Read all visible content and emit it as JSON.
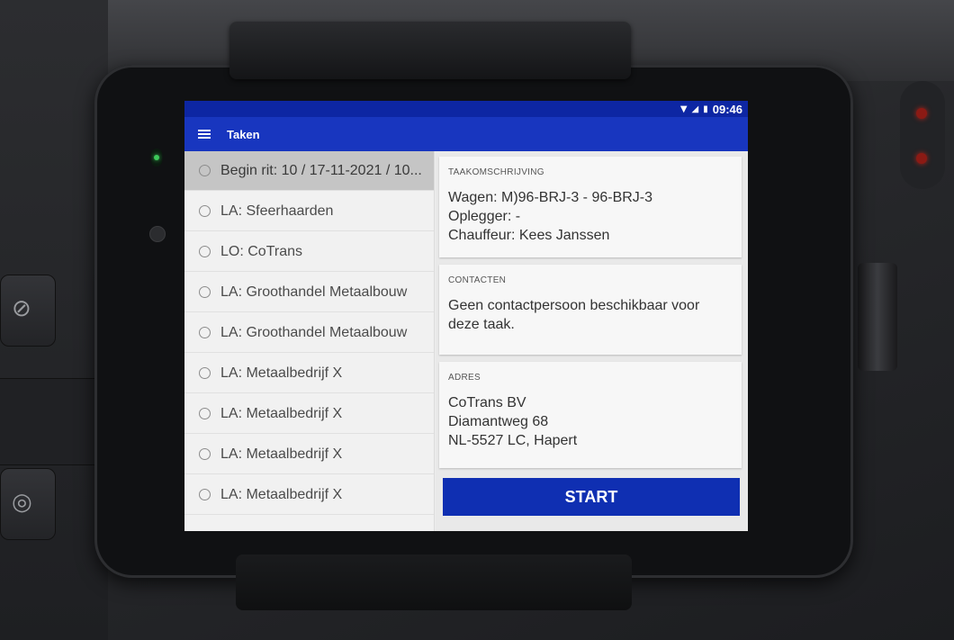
{
  "statusbar": {
    "time": "09:46",
    "icons": [
      "wifi-icon",
      "signal-icon",
      "battery-icon"
    ]
  },
  "toolbar": {
    "title": "Taken"
  },
  "tasks": [
    {
      "label": "Begin rit: 10 / 17-11-2021 / 10...",
      "selected": true
    },
    {
      "label": "LA: Sfeerhaarden"
    },
    {
      "label": "LO: CoTrans"
    },
    {
      "label": "LA: Groothandel Metaalbouw"
    },
    {
      "label": "LA: Groothandel Metaalbouw"
    },
    {
      "label": "LA: Metaalbedrijf X"
    },
    {
      "label": "LA: Metaalbedrijf X"
    },
    {
      "label": "LA: Metaalbedrijf X"
    },
    {
      "label": "LA: Metaalbedrijf X"
    }
  ],
  "details": {
    "description": {
      "header": "TAAKOMSCHRIJVING",
      "lines": [
        "Wagen: M)96-BRJ-3 - 96-BRJ-3",
        "Oplegger:  -",
        "Chauffeur: Kees Janssen"
      ]
    },
    "contacts": {
      "header": "CONTACTEN",
      "lines": [
        "Geen contactpersoon beschikbaar voor",
        "deze taak."
      ]
    },
    "address": {
      "header": "ADRES",
      "lines": [
        "CoTrans BV",
        "Diamantweg 68",
        "NL-5527 LC, Hapert"
      ]
    }
  },
  "actions": {
    "start_label": "START"
  },
  "colors": {
    "primary": "#1836bf",
    "statusbar": "#0d26a3",
    "button": "#0f2fb2"
  }
}
